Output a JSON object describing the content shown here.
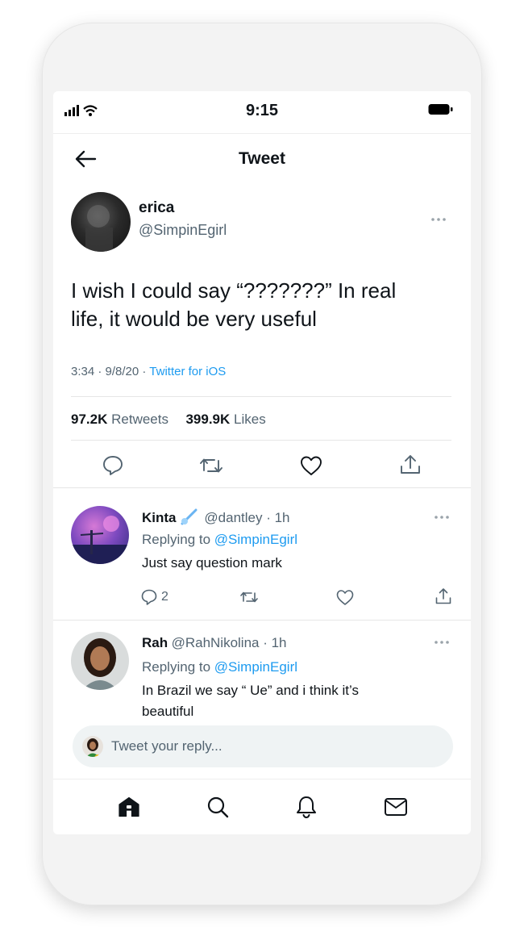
{
  "status_bar": {
    "time": "9:15"
  },
  "header": {
    "title": "Tweet"
  },
  "tweet": {
    "author": {
      "name": "erica",
      "handle": "@SimpinEgirl"
    },
    "text_line1": "I wish I could say “???????” In real",
    "text_line2": "life, it would be very useful",
    "meta": {
      "time": "3:34 · 9/8/20 · ",
      "source": "Twitter for iOS"
    },
    "stats": {
      "retweets_count": "97.2K",
      "retweets_label": "Retweets",
      "likes_count": "399.9K",
      "likes_label": "Likes"
    }
  },
  "replies": [
    {
      "name": "Kinta",
      "handle_time": "@dantley · 1h",
      "replying_prefix": "Replying to ",
      "replying_to": "@SimpinEgirl",
      "text": "Just say question mark",
      "reply_count": "2"
    },
    {
      "name": "Rah",
      "handle_time": "@RahNikolina · 1h",
      "replying_prefix": "Replying to ",
      "replying_to": "@SimpinEgirl",
      "text_line1": "In Brazil we say “ Ue” and i think it’s",
      "text_line2": "beautiful"
    }
  ],
  "composer": {
    "placeholder": "Tweet your reply..."
  },
  "tab_bar": {
    "items": [
      "home-icon",
      "search-icon",
      "notifications-icon",
      "messages-icon"
    ]
  },
  "colors": {
    "accent": "#1d9bf0",
    "text": "#0f1419",
    "muted": "#536471"
  }
}
